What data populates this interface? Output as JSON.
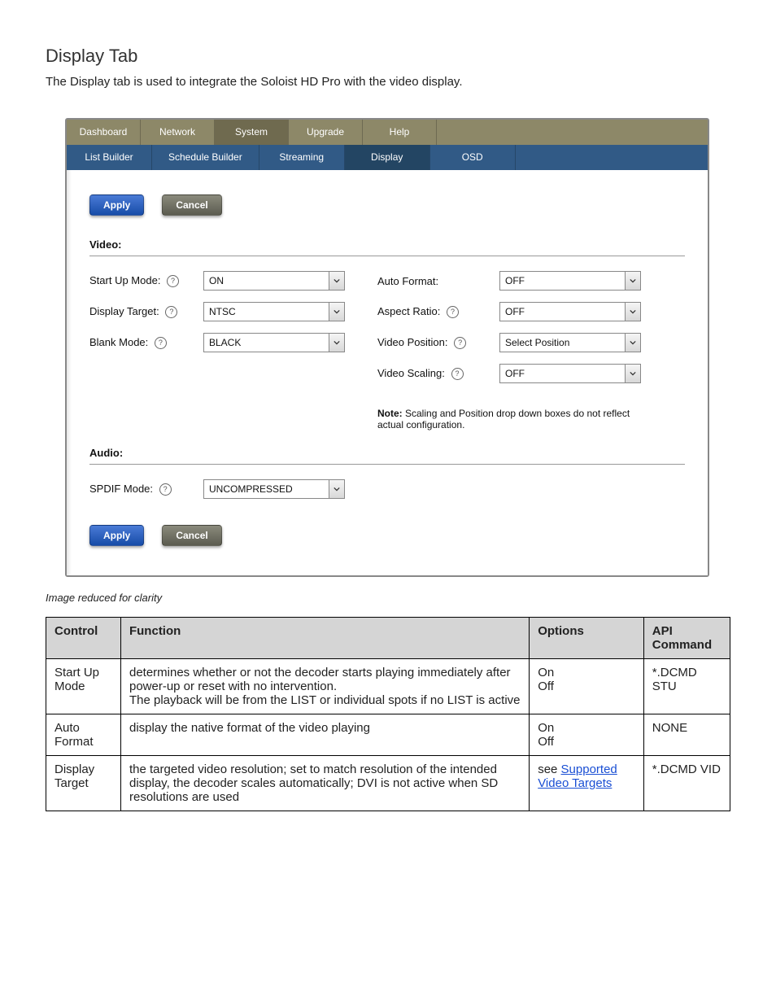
{
  "title": "Display Tab",
  "intro": "The Display tab is used to integrate the Soloist HD Pro with the video display.",
  "nav_top": [
    "Dashboard",
    "Network",
    "System",
    "Upgrade",
    "Help"
  ],
  "nav_sub": [
    "List Builder",
    "Schedule Builder",
    "Streaming",
    "Display",
    "OSD"
  ],
  "buttons": {
    "apply": "Apply",
    "cancel": "Cancel"
  },
  "sections": {
    "video": "Video:",
    "audio": "Audio:"
  },
  "fields": {
    "start_up_mode": {
      "label": "Start Up Mode:",
      "value": "ON"
    },
    "display_target": {
      "label": "Display Target:",
      "value": "NTSC"
    },
    "blank_mode": {
      "label": "Blank Mode:",
      "value": "BLACK"
    },
    "auto_format": {
      "label": "Auto Format:",
      "value": "OFF"
    },
    "aspect_ratio": {
      "label": "Aspect Ratio:",
      "value": "OFF"
    },
    "video_position": {
      "label": "Video Position:",
      "value": "Select Position"
    },
    "video_scaling": {
      "label": "Video Scaling:",
      "value": "OFF"
    },
    "spdif_mode": {
      "label": "SPDIF Mode:",
      "value": "UNCOMPRESSED"
    }
  },
  "note_label": "Note:",
  "note_text": " Scaling and Position drop down boxes do not reflect actual configuration.",
  "caption": "Image reduced for clarity",
  "table": {
    "headers": [
      "Control",
      "Function",
      "Options",
      "API Command"
    ],
    "rows": [
      {
        "control": "Start Up Mode",
        "function": "determines whether or not the decoder starts playing immediately after power-up or reset with no intervention.\nThe playback will be from the LIST or individual spots if no LIST is active",
        "options": "On\nOff",
        "api": "*.DCMD STU"
      },
      {
        "control": "Auto Format",
        "function": "display the native format of the video playing",
        "options": "On\nOff",
        "api": "NONE"
      },
      {
        "control": "Display Target",
        "function": "the targeted video resolution; set to match resolution of the intended display, the decoder scales automatically; DVI is not active when SD resolutions are used",
        "options_prefix": "see ",
        "options_link": "Supported Video Targets",
        "api": "*.DCMD VID"
      }
    ]
  }
}
